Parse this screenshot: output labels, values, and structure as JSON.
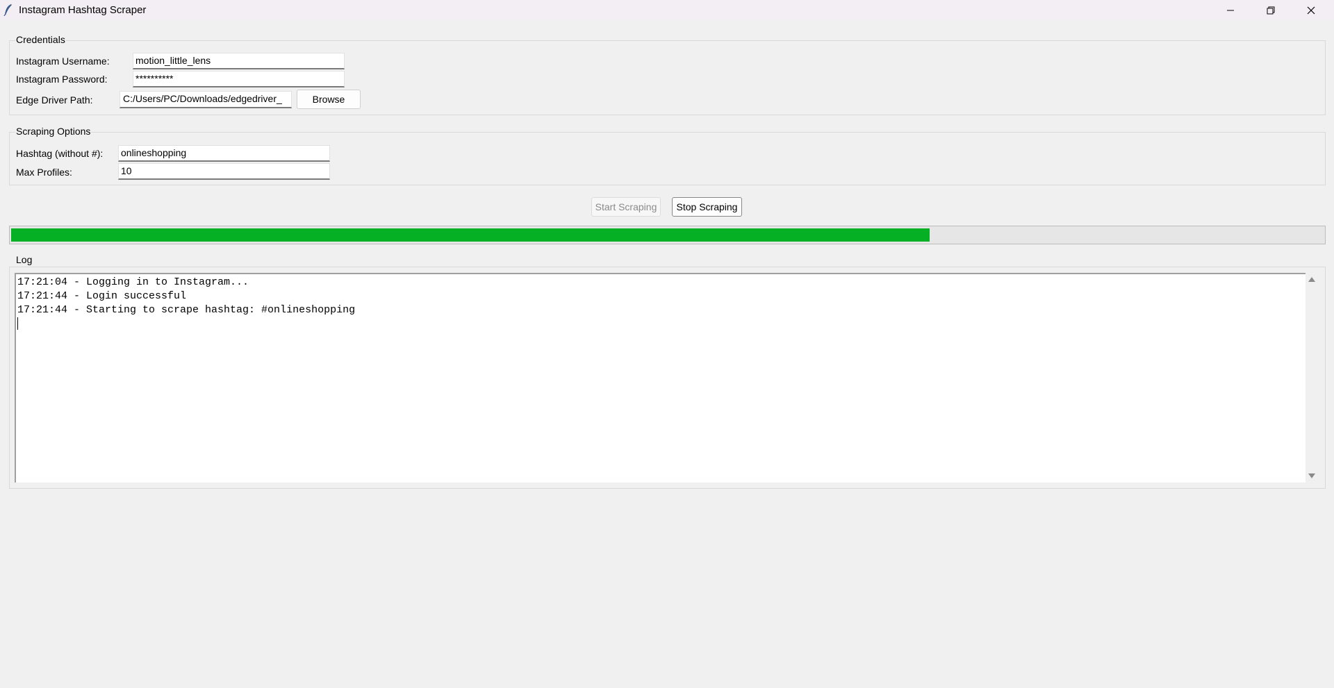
{
  "window": {
    "title": "Instagram Hashtag Scraper",
    "minimize_icon": "minimize-icon",
    "maximize_icon": "restore-icon",
    "close_icon": "close-icon"
  },
  "credentials": {
    "legend": "Credentials",
    "username_label": "Instagram Username:",
    "username_value": "motion_little_lens",
    "password_label": "Instagram Password:",
    "password_value": "**********",
    "driver_label": "Edge Driver Path:",
    "driver_value": "C:/Users/PC/Downloads/edgedriver_",
    "browse_label": "Browse"
  },
  "options": {
    "legend": "Scraping Options",
    "hashtag_label": "Hashtag (without #):",
    "hashtag_value": "onlineshopping",
    "max_label": "Max Profiles:",
    "max_value": "10"
  },
  "actions": {
    "start_label": "Start Scraping",
    "start_enabled": false,
    "stop_label": "Stop Scraping"
  },
  "progress": {
    "fraction": 0.7
  },
  "log": {
    "legend": "Log",
    "lines": [
      "17:21:04 - Logging in to Instagram...",
      "17:21:44 - Login successful",
      "17:21:44 - Starting to scrape hashtag: #onlineshopping"
    ]
  },
  "colors": {
    "progress_fill": "#06b025",
    "background": "#f0f0f0"
  }
}
